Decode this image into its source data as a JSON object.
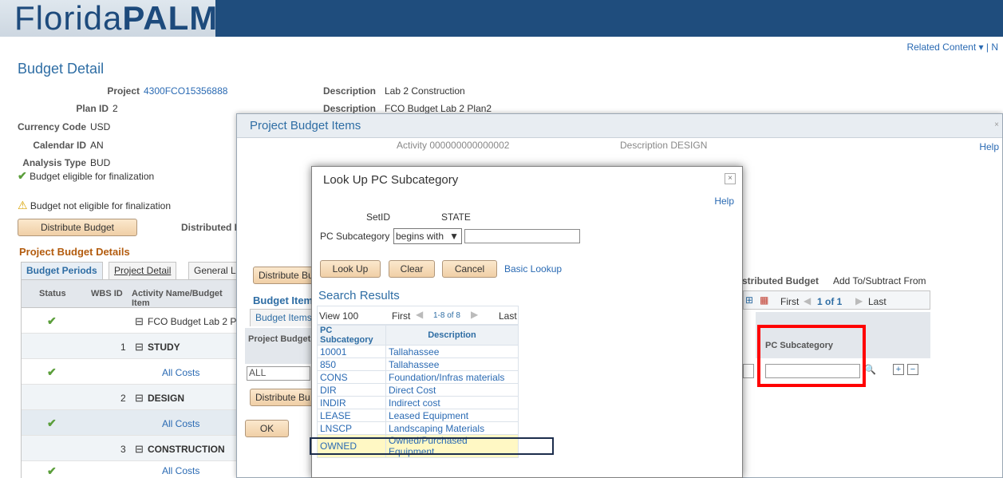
{
  "header": {
    "brand_light": "Florida",
    "brand_bold": "PALM",
    "related": "Related Content ▾  |  N"
  },
  "page": {
    "title": "Budget Detail",
    "fields": [
      {
        "label": "Project",
        "value": "4300FCO15356888"
      },
      {
        "label": "Plan ID",
        "value": "2"
      },
      {
        "label": "Currency Code",
        "value": "USD"
      },
      {
        "label": "Calendar ID",
        "value": "AN"
      },
      {
        "label": "Analysis Type",
        "value": "BUD"
      }
    ],
    "desc1_label": "Description",
    "desc1_value": "Lab 2 Construction",
    "desc2_label": "Description",
    "desc2_value": "FCO Budget Lab 2 Plan2",
    "eligible": "Budget eligible for finalization",
    "not_eligible": "Budget not eligible for finalization",
    "distribute_btn": "Distribute Budget",
    "distributed_label": "Distributed B",
    "section": "Project Budget Details",
    "tabs": [
      "Budget Periods",
      "Project Detail",
      "General L"
    ],
    "grid_headers": [
      "Status",
      "WBS ID",
      "Activity Name/Budget Item"
    ],
    "rows": [
      {
        "wbs": "",
        "name": "FCO Budget Lab 2 P",
        "type": "tree"
      },
      {
        "wbs": "1",
        "name": "STUDY",
        "type": "tree"
      },
      {
        "wbs": "",
        "name": "All Costs",
        "type": "link"
      },
      {
        "wbs": "2",
        "name": "DESIGN",
        "type": "tree"
      },
      {
        "wbs": "",
        "name": "All Costs",
        "type": "link"
      },
      {
        "wbs": "3",
        "name": "CONSTRUCTION",
        "type": "tree"
      },
      {
        "wbs": "",
        "name": "All Costs",
        "type": "link"
      }
    ]
  },
  "modal1": {
    "title": "Project Budget Items",
    "help": "Help",
    "activity": "Activity 000000000000002",
    "description": "Description DESIGN",
    "distribute_btn": "Distribute Bu",
    "budget_items_hdr": "Budget Item",
    "budget_items_tab": "Budget Items",
    "project_budget": "Project Budget",
    "all_value": "ALL",
    "distribute_btn2": "Distribute Bu",
    "ok": "OK",
    "distributed_budget": "stributed Budget",
    "add_sub": "Add To/Subtract From",
    "first": "First",
    "page": "1 of 1",
    "last": "Last",
    "pc_subcat": "PC Subcategory"
  },
  "modal2": {
    "title": "Look Up PC Subcategory",
    "help": "Help",
    "setid_label": "SetID",
    "setid_value": "STATE",
    "pc_label": "PC Subcategory",
    "operator": "begins with",
    "input_value": "",
    "lookup_btn": "Look Up",
    "clear_btn": "Clear",
    "cancel_btn": "Cancel",
    "basic_link": "Basic Lookup",
    "results_title": "Search Results",
    "view": "View 100",
    "first": "First",
    "count": "1-8 of 8",
    "last": "Last",
    "col1": "PC Subcategory",
    "col2": "Description",
    "results": [
      {
        "code": "10001",
        "desc": "Tallahassee"
      },
      {
        "code": "850",
        "desc": "Tallahassee"
      },
      {
        "code": "CONS",
        "desc": "Foundation/Infras materials"
      },
      {
        "code": "DIR",
        "desc": "Direct Cost"
      },
      {
        "code": "INDIR",
        "desc": "Indirect cost"
      },
      {
        "code": "LEASE",
        "desc": "Leased Equipment"
      },
      {
        "code": "LNSCP",
        "desc": "Landscaping Materials"
      },
      {
        "code": "OWNED",
        "desc": "Owned/Purchased Equipment"
      }
    ]
  },
  "colors": {
    "brand": "#1d4a7c",
    "link": "#2a6ab3",
    "highlight": "#ff0000",
    "selection": "#fff8c4"
  }
}
